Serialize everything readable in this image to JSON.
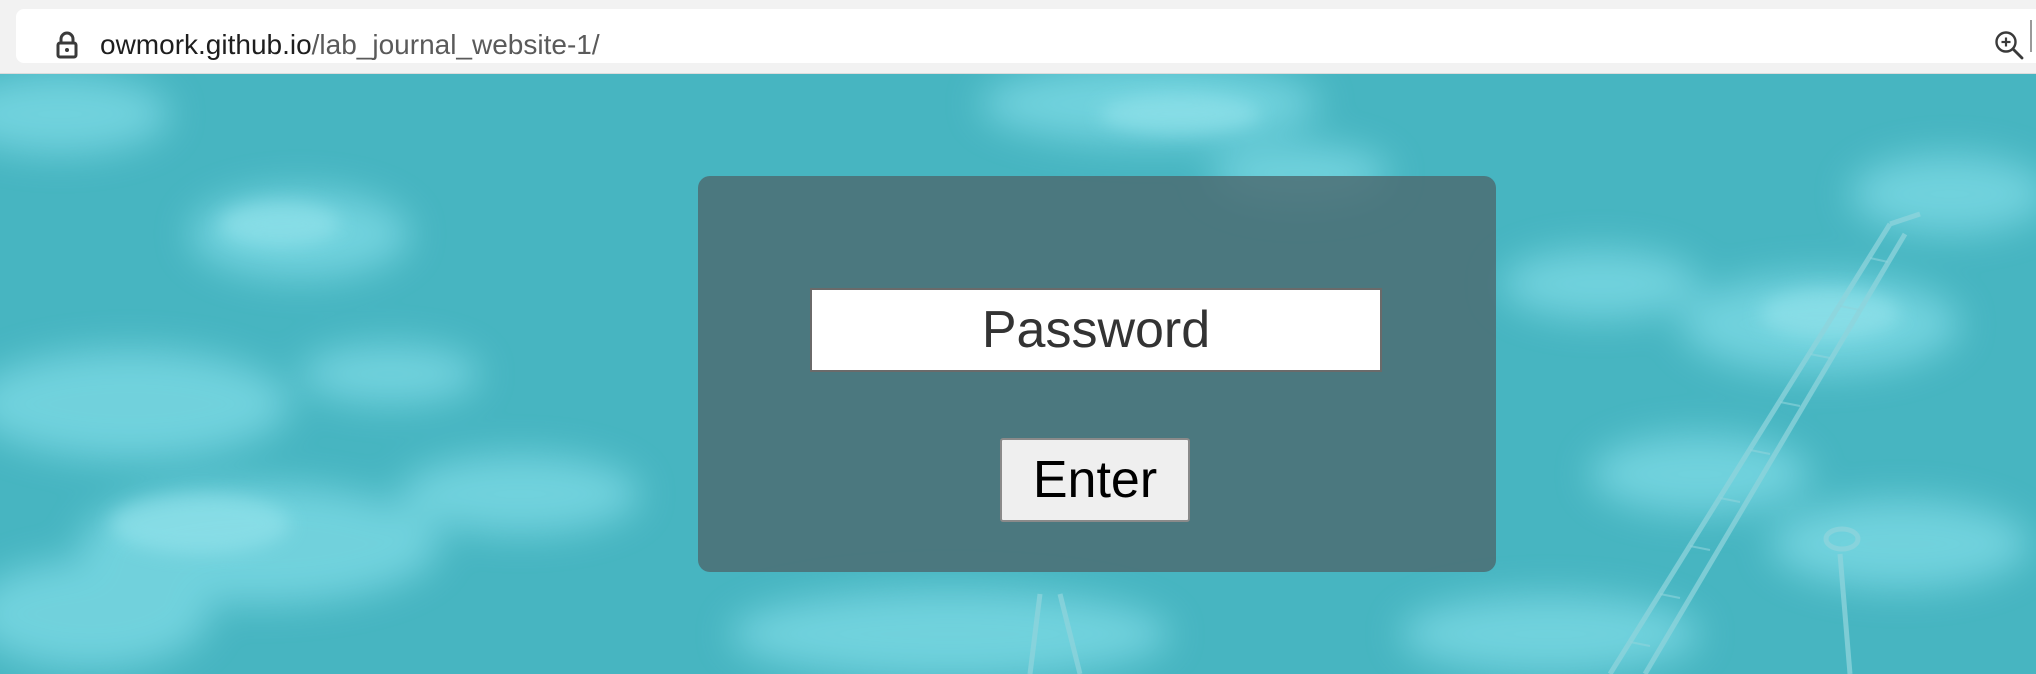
{
  "browser": {
    "url_domain": "owmork.github.io",
    "url_path": "/lab_journal_website-1/",
    "icons": [
      "lock-icon",
      "zoom-in-icon"
    ]
  },
  "login": {
    "password_placeholder": "Password",
    "password_value": "",
    "enter_label": "Enter"
  },
  "colors": {
    "background": "#4bb8c4",
    "panel": "#4c6a70",
    "input_bg": "#ffffff",
    "button_bg": "#efefef"
  }
}
